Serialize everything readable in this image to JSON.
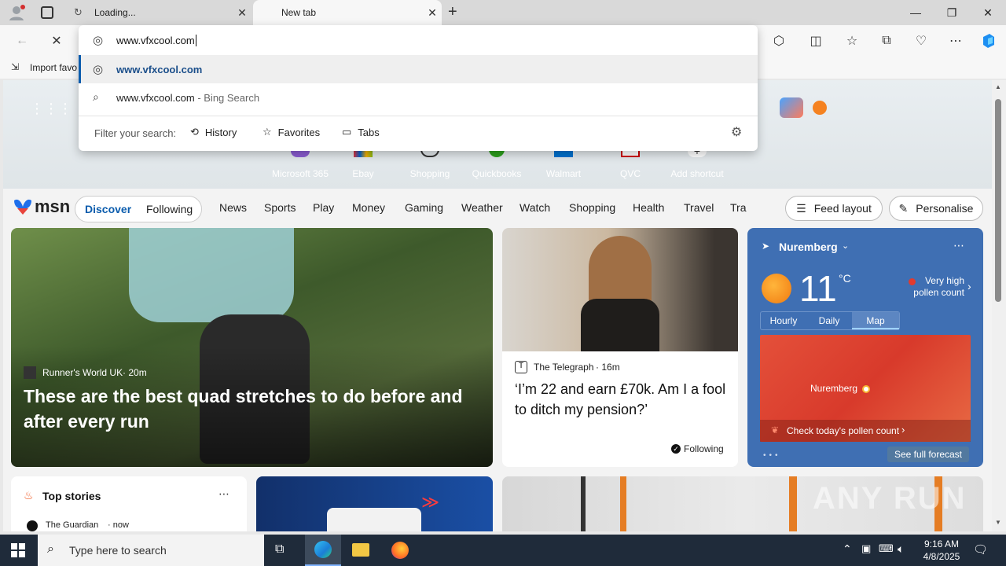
{
  "browser": {
    "tabs": [
      {
        "title": "Loading...",
        "active": false
      },
      {
        "title": "New tab",
        "active": true
      }
    ],
    "address_value": "www.vfxcool.com",
    "favorites_import": "Import favo"
  },
  "omnibox": {
    "suggestions": [
      {
        "text": "www.vfxcool.com",
        "suffix": "",
        "icon": "globe-icon"
      },
      {
        "text": "www.vfxcool.com",
        "suffix": " - Bing Search",
        "icon": "search-icon"
      }
    ],
    "filter_label": "Filter your search:",
    "filters": [
      "History",
      "Favorites",
      "Tabs"
    ]
  },
  "shortcuts": [
    "Microsoft 365",
    "Ebay",
    "Shopping",
    "Quickbooks",
    "Walmart",
    "QVC",
    "Add shortcut"
  ],
  "msn": {
    "logo": "msn",
    "toggle": [
      "Discover",
      "Following"
    ],
    "nav": [
      "News",
      "Sports",
      "Play",
      "Money",
      "Gaming",
      "Weather",
      "Watch",
      "Shopping",
      "Health",
      "Travel",
      "Tra"
    ],
    "feed_layout": "Feed layout",
    "personalise": "Personalise"
  },
  "hero": {
    "source": "Runner's World UK",
    "age": "20m",
    "headline": "These are the best quad stretches to do before and after every run"
  },
  "story2": {
    "source": "The Telegraph",
    "age": "16m",
    "headline": "‘I’m 22 and earn £70k. Am I a fool to ditch my pension?’",
    "following": "Following"
  },
  "weather": {
    "location": "Nuremberg",
    "temp": "11",
    "unit": "°C",
    "pollen": "Very high pollen count",
    "tabs": [
      "Hourly",
      "Daily",
      "Map"
    ],
    "map_label": "Nuremberg",
    "pollen_link": "Check today's pollen count",
    "forecast_link": "See full forecast"
  },
  "top_stories": {
    "title": "Top stories",
    "first_source": "The Guardian",
    "first_age": "now"
  },
  "watermark": "ANY RUN",
  "taskbar": {
    "search_placeholder": "Type here to search",
    "time": "9:16 AM",
    "date": "4/8/2025"
  },
  "colors": {
    "accent": "#0b5cad",
    "weather_bg": "#3f6fb3",
    "taskbar": "#1f2b3a"
  }
}
